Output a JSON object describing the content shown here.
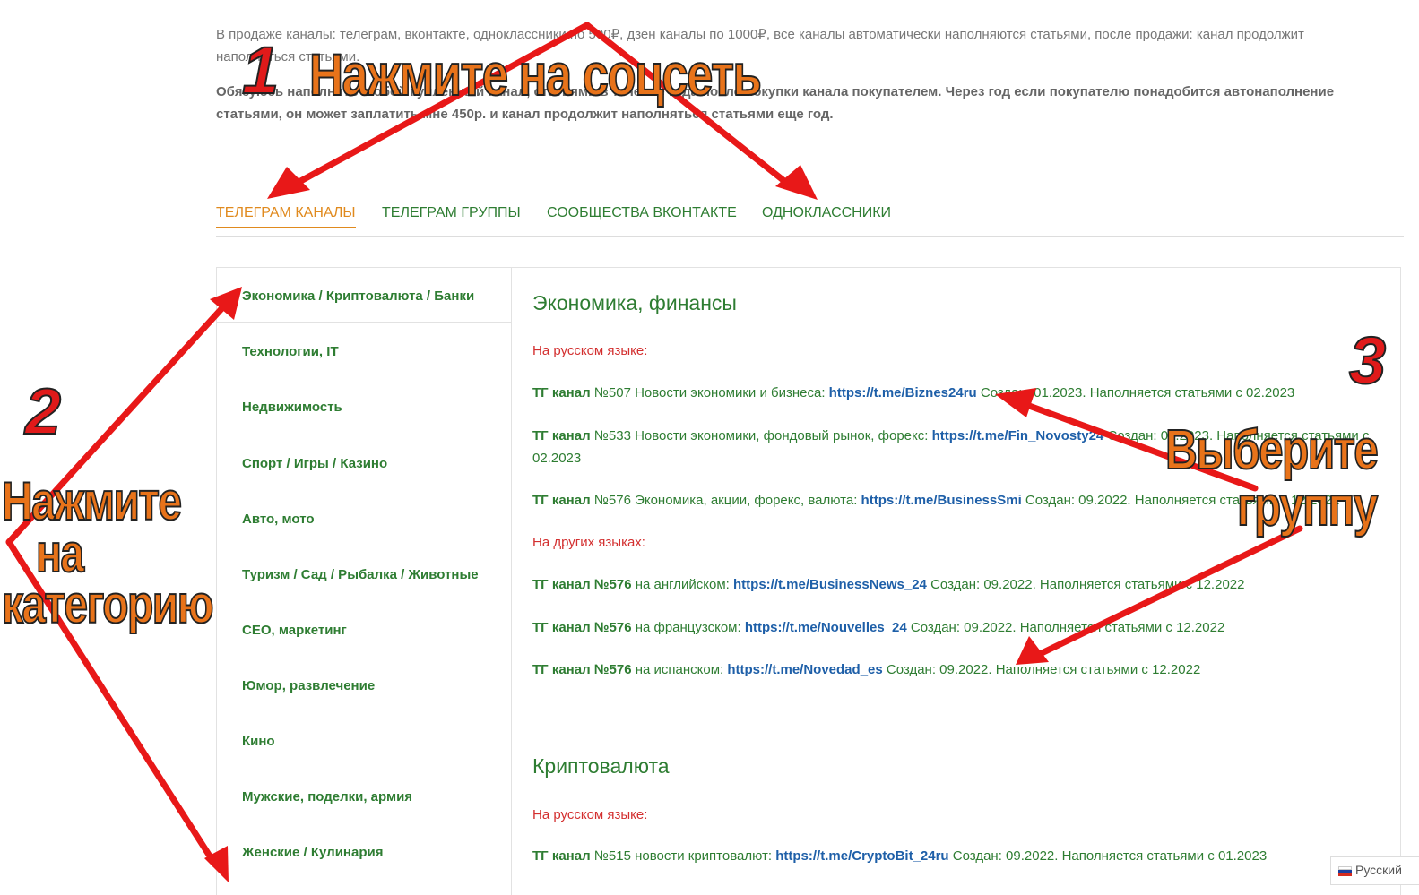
{
  "intro": {
    "line1": "В продаже каналы: телеграм, вконтакте, одноклассники по 500₽, дзен каналы по 1000₽, все каналы автоматически наполняются статьями, после продажи: канал продолжит наполняться статьями.",
    "line2": "Обязуюсь наполнять любой купленный канал, статьями в течение года после покупки канала покупателем. Через год если покупателю понадобится автонаполнение статьями, он может заплатить мне 450р. и канал продолжит наполняться статьями еще год."
  },
  "tabs": [
    "ТЕЛЕГРАМ КАНАЛЫ",
    "ТЕЛЕГРАМ ГРУППЫ",
    "СООБЩЕСТВА ВКОНТАКТЕ",
    "ОДНОКЛАССНИКИ"
  ],
  "sidebar": [
    "Экономика / Криптовалюта / Банки",
    "Технологии, IT",
    "Недвижимость",
    "Спорт / Игры / Казино",
    "Авто, мото",
    "Туризм / Сад / Рыбалка / Животные",
    "СЕО, маркетинг",
    "Юмор, развлечение",
    "Кино",
    "Мужские, поделки, армия",
    "Женские / Кулинария"
  ],
  "sections": [
    {
      "title": "Экономика, финансы",
      "ru_label": "На русском языке:",
      "other_label": "На других языках:",
      "rows": [
        {
          "prefix": "ТГ канал",
          "text": " №507 Новости экономики и бизнеса: ",
          "link": "https://t.me/Biznes24ru",
          "tail": "   Создан: 01.2023. Наполняется статьями с 02.2023"
        },
        {
          "prefix": "ТГ канал",
          "text": " №533 Новости экономики, фондовый рынок, форекс: ",
          "link": "https://t.me/Fin_Novosty24",
          "tail": "  Создан: 01.2023. Наполняется статьями с 02.2023"
        },
        {
          "prefix": "ТГ канал",
          "text": " №576 Экономика, акции, форекс, валюта: ",
          "link": "https://t.me/BusinessSmi",
          "tail": "  Создан: 09.2022. Наполняется статьями с 12.2022"
        },
        {
          "prefix": "ТГ канал №576",
          "text": " на английском: ",
          "link": "https://t.me/BusinessNews_24",
          "tail": "  Создан: 09.2022. Наполняется статьями с 12.2022"
        },
        {
          "prefix": "ТГ канал №576",
          "text": " на французском: ",
          "link": "https://t.me/Nouvelles_24",
          "tail": "  Создан: 09.2022. Наполняется статьями с 12.2022"
        },
        {
          "prefix": "ТГ канал №576",
          "text": " на испанском: ",
          "link": "https://t.me/Novedad_es",
          "tail": "  Создан: 09.2022. Наполняется статьями с 12.2022"
        }
      ]
    },
    {
      "title": "Криптовалюта",
      "ru_label": "На русском языке:",
      "rows": [
        {
          "prefix": "ТГ канал",
          "text": " №515 новости криптовалют:  ",
          "link": "https://t.me/CryptoBit_24ru",
          "tail": "  Создан: 09.2022. Наполняется статьями с 01.2023"
        }
      ]
    }
  ],
  "language_badge": "Русский",
  "annotations": {
    "step1_num": "1",
    "step1_text": "Нажмите на соцсеть",
    "step2_num": "2",
    "step2_line1": "Нажмите",
    "step2_line2": "на",
    "step2_line3": "категорию",
    "step3_num": "3",
    "step3_line1": "Выберите",
    "step3_line2": "группу",
    "arrow_color": "#e81818"
  }
}
